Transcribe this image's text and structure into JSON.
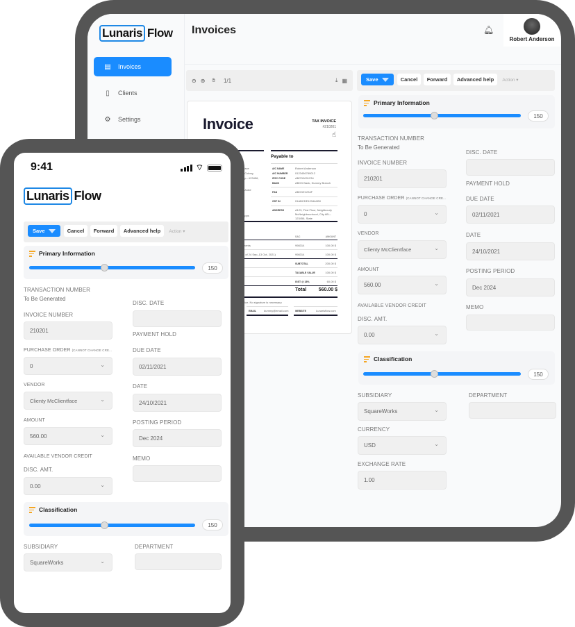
{
  "brand": {
    "name_boxed": "Lunaris",
    "name_rest": "Flow",
    "accent": "#1a8cff"
  },
  "tablet": {
    "sidebar": {
      "items": [
        {
          "label": "Invoices",
          "icon": "invoice-icon",
          "active": true
        },
        {
          "label": "Clients",
          "icon": "document-icon",
          "active": false
        },
        {
          "label": "Settings",
          "icon": "gear-icon",
          "active": false
        }
      ]
    },
    "header": {
      "title": "Invoices",
      "user_name": "Robert Anderson"
    },
    "pdf_toolbar": {
      "page": "1/1"
    },
    "invoice_preview": {
      "title": "Invoice",
      "tax_invoice_label": "TAX INVOICE",
      "invoice_number": "#210201",
      "payable_to_label": "Payable to",
      "payee": [
        {
          "key": "A/C NAME",
          "value": "Robert Anderson"
        },
        {
          "key": "A/C NUMBER",
          "value": "0123456789012"
        },
        {
          "key": "IFSC CODE",
          "value": "ABCD0001234"
        },
        {
          "key": "BANK",
          "value": "ABCD Bank, Dummy Branch"
        },
        {
          "key": "PAN",
          "value": "ABCDE1234F"
        },
        {
          "key": "GST IN",
          "value": "01ABCDE1234A1B0"
        },
        {
          "key": "ADDRESS",
          "value": "A123, First Floor, Neighbourly McNeighbourhood, City AB—123456, State"
        }
      ],
      "left_fragments": [
        "tface",
        "pColony,",
        "ity—123456,",
        "4A182",
        "apps"
      ],
      "items_header": {
        "sac": "SAC",
        "amount": "AMOUNT"
      },
      "items": [
        {
          "desc": "ments",
          "sac": "998314",
          "amount": "100.00 $"
        },
        {
          "desc": "d of 24 Sep–13 Oct, 2021)",
          "sac": "998314",
          "amount": "100.00 $"
        }
      ],
      "subtotal": {
        "label": "SUBTOTAL",
        "value": "200.00 $"
      },
      "taxable": {
        "label": "TAXABLE VALUE",
        "value": "100.00 $"
      },
      "gst": {
        "label": "IGST @ 18%",
        "value": "60.00 $"
      },
      "total": {
        "label": "Total",
        "value": "560.00 $"
      },
      "note": "oice. No signature is necessary.",
      "email": {
        "label": "EMAIL",
        "value": "dummy@email.com"
      },
      "website": {
        "label": "WEBSITE",
        "value": "Lunarisflow.com"
      }
    }
  },
  "toolbar": {
    "save": "Save",
    "cancel": "Cancel",
    "forward": "Forward",
    "advanced_help": "Advanced help",
    "action": "Action ▾"
  },
  "primary_info": {
    "title": "Primary Information",
    "slider_value": "150",
    "slider_fraction": 0.45
  },
  "classification": {
    "title": "Classification",
    "slider_value": "150",
    "slider_fraction": 0.45
  },
  "form": {
    "transaction_number_label": "TRANSACTION NUMBER",
    "transaction_number_value": "To Be Generated",
    "invoice_number_label": "INVOICE NUMBER",
    "invoice_number_value": "210201",
    "purchase_order_label": "PURCHASE ORDER",
    "purchase_order_note": "(CANNOT CHANGE CRE...",
    "purchase_order_value": "0",
    "vendor_label": "VENDOR",
    "vendor_value": "Clienty McClientface",
    "amount_label": "AMOUNT",
    "amount_value": "560.00",
    "available_credit_label": "AVAILABLE VENDOR CREDIT",
    "disc_amt_label": "DISC. AMT.",
    "disc_amt_value": "0.00",
    "disc_date_label": "DISC. DATE",
    "disc_date_value": "",
    "payment_hold_label": "PAYMENT HOLD",
    "due_date_label": "DUE DATE",
    "due_date_value": "02/11/2021",
    "date_label": "DATE",
    "date_value": "24/10/2021",
    "posting_period_label": "POSTING PERIOD",
    "posting_period_value": "Dec 2024",
    "memo_label": "MEMO",
    "memo_value": "",
    "subsidiary_label": "SUBSIDIARY",
    "subsidiary_value": "SquareWorks",
    "department_label": "DEPARTMENT",
    "department_value": "",
    "currency_label": "CURRENCY",
    "currency_value": "USD",
    "exchange_rate_label": "EXCHANGE RATE",
    "exchange_rate_value": "1.00"
  },
  "phone": {
    "time": "9:41"
  }
}
